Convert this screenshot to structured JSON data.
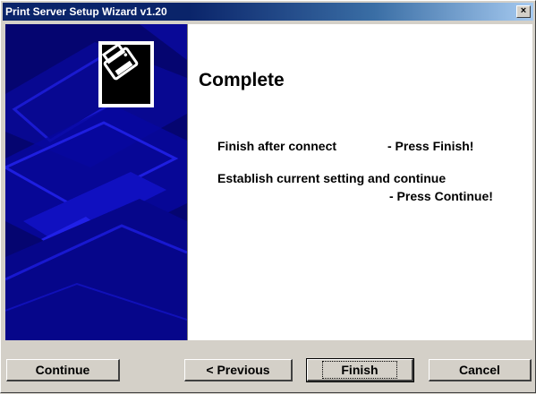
{
  "window": {
    "title": "Print Server Setup Wizard v1.20",
    "close_glyph": "×"
  },
  "main": {
    "heading": "Complete",
    "line1_left": "Finish after connect",
    "line1_right": "- Press Finish!",
    "line2": "Establish current setting and continue",
    "line3": "- Press Continue!"
  },
  "buttons": {
    "continue": "Continue",
    "previous": "< Previous",
    "finish": "Finish",
    "cancel": "Cancel"
  },
  "icons": {
    "logo": "printer-icon",
    "close": "close-icon"
  },
  "colors": {
    "titlebar": "#0a246a",
    "side_panel": "#04047a",
    "face": "#d4d0c8"
  }
}
